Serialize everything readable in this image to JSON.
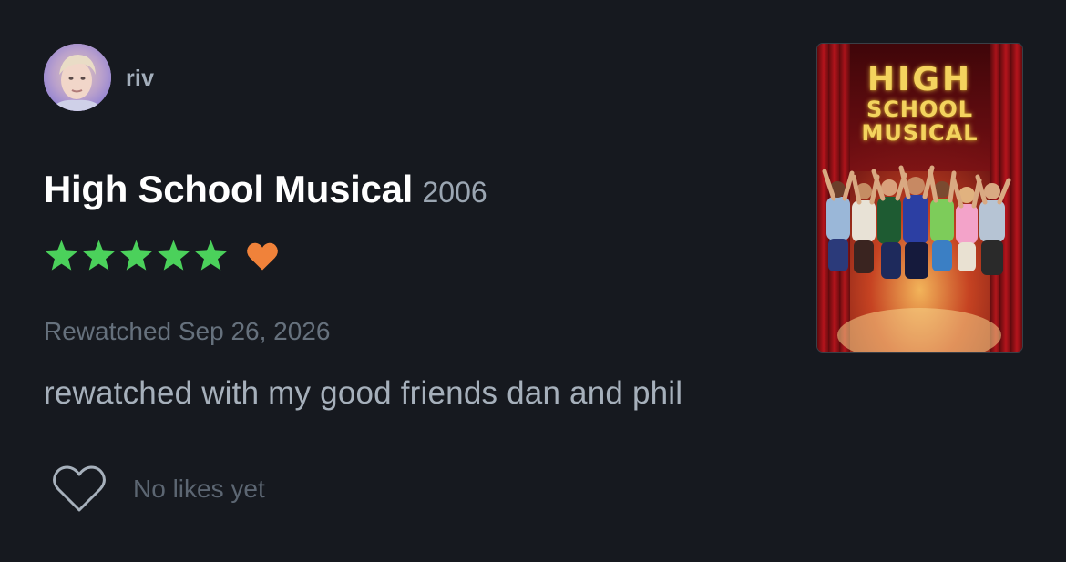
{
  "user": {
    "name": "riv",
    "avatar_icon": "user-avatar"
  },
  "film": {
    "title": "High School Musical",
    "year": "2006",
    "poster_icon": "film-poster"
  },
  "rating": {
    "stars": 5,
    "max_stars": 5,
    "star_color": "#4bd15b",
    "liked": true,
    "liked_color": "#f0823a"
  },
  "watched": {
    "label": "Rewatched Sep 26, 2026"
  },
  "review": {
    "text": "rewatched with my good friends dan and phil"
  },
  "likes": {
    "icon": "heart-outline-icon",
    "count_label": "No likes yet"
  },
  "colors": {
    "background": "#16191f",
    "title": "#ffffff",
    "muted": "#66717d"
  }
}
